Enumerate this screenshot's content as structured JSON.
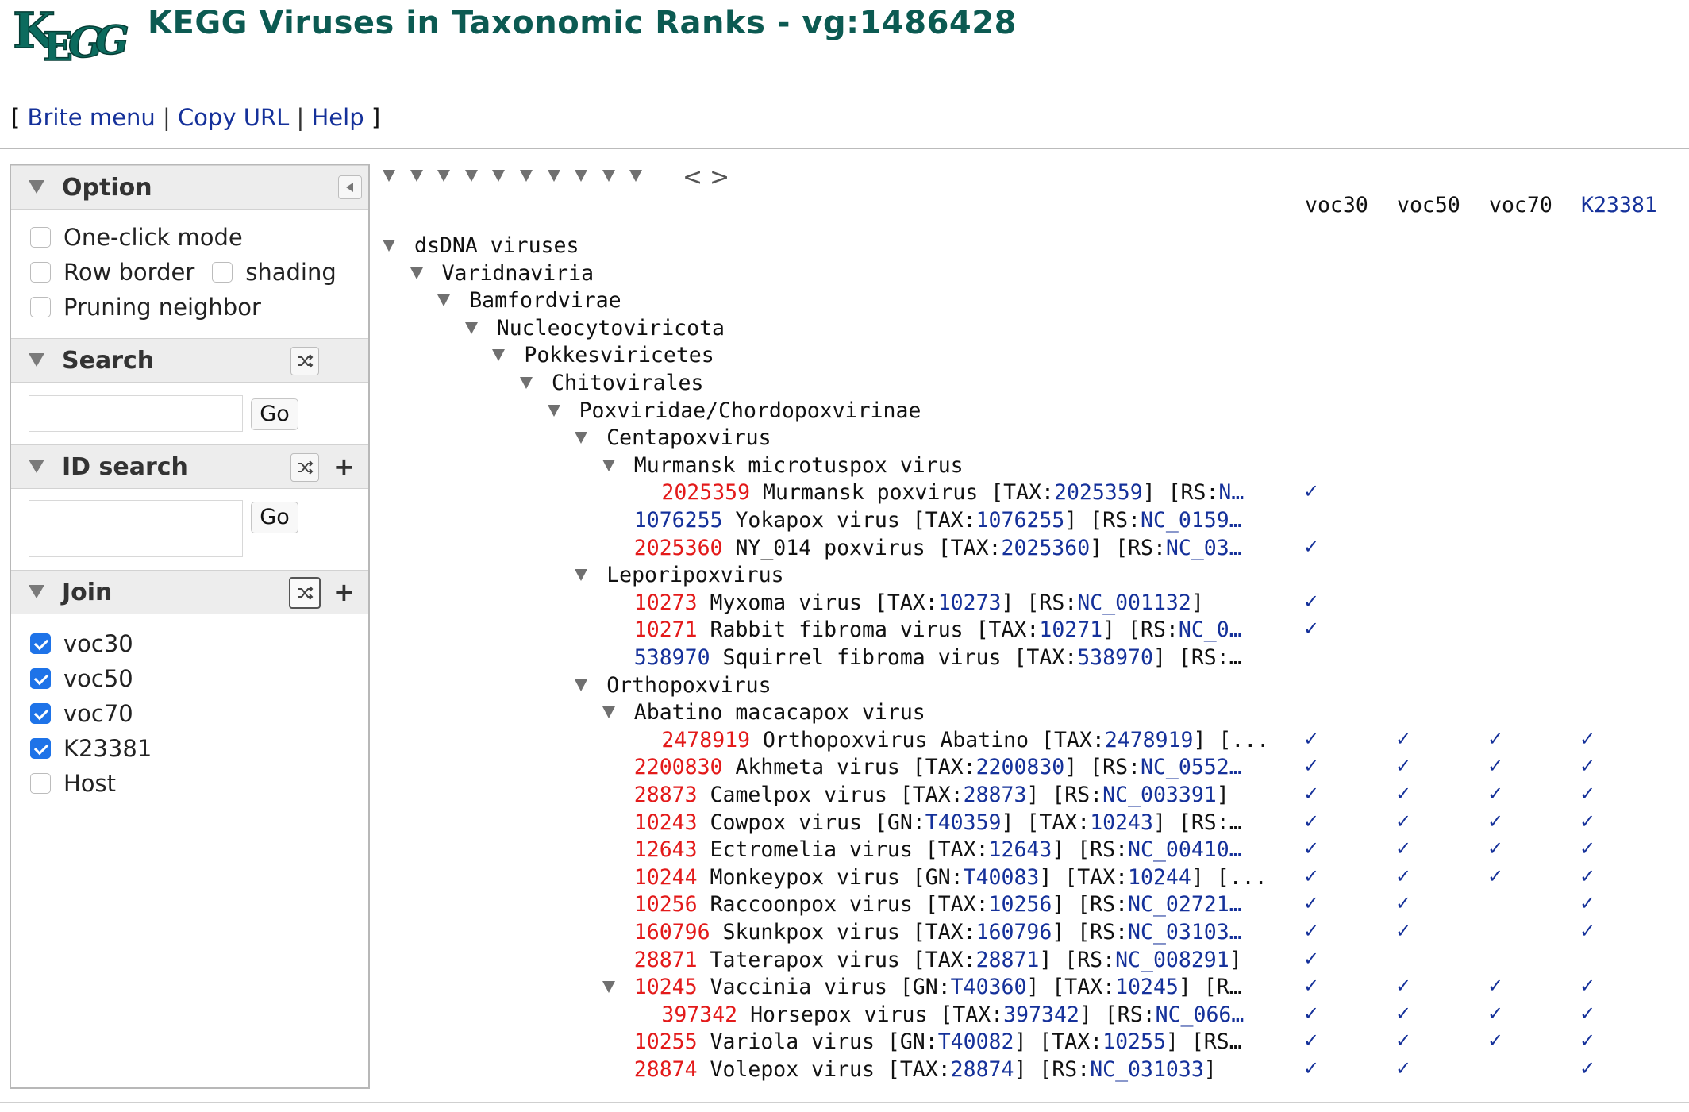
{
  "header": {
    "logo_text": "KEGG",
    "title": "KEGG Viruses in Taxonomic Ranks - vg:1486428",
    "menu": {
      "open": "[",
      "close": "]",
      "sep": "|",
      "brite": "Brite menu",
      "copy": "Copy URL",
      "help": "Help"
    }
  },
  "colors": {
    "title": "#0c5a52",
    "link": "#15319a",
    "id_red": "#e31a1a",
    "checkbox": "#1e73e8"
  },
  "left_panel": {
    "option": {
      "title": "Option",
      "items": [
        {
          "label": "One-click mode",
          "checked": false
        },
        {
          "label": "Row border",
          "checked": false
        },
        {
          "label": "shading",
          "checked": false
        },
        {
          "label": "Pruning neighbor",
          "checked": false
        }
      ]
    },
    "search": {
      "title": "Search",
      "value": "",
      "go": "Go",
      "icon": "shuffle-icon"
    },
    "id_search": {
      "title": "ID search",
      "value": "",
      "go": "Go",
      "icon": "shuffle-icon",
      "plus": "+"
    },
    "join": {
      "title": "Join",
      "plus": "+",
      "icon": "shuffle-icon",
      "items": [
        {
          "label": "voc30",
          "checked": true
        },
        {
          "label": "voc50",
          "checked": true
        },
        {
          "label": "voc70",
          "checked": true
        },
        {
          "label": "K23381",
          "checked": true
        },
        {
          "label": "Host",
          "checked": false
        }
      ]
    }
  },
  "tree": {
    "nav_prev": "<",
    "nav_next": ">",
    "columns": [
      "voc30",
      "voc50",
      "voc70",
      "K23381"
    ],
    "check_symbol": "✓",
    "rows": [
      {
        "indent": 0,
        "tri": true,
        "parts": [
          [
            "n",
            "dsDNA viruses"
          ]
        ],
        "checks": [
          0,
          0,
          0,
          0
        ]
      },
      {
        "indent": 1,
        "tri": true,
        "parts": [
          [
            "n",
            "Varidnaviria"
          ]
        ],
        "checks": [
          0,
          0,
          0,
          0
        ]
      },
      {
        "indent": 2,
        "tri": true,
        "parts": [
          [
            "n",
            "Bamfordvirae"
          ]
        ],
        "checks": [
          0,
          0,
          0,
          0
        ]
      },
      {
        "indent": 3,
        "tri": true,
        "parts": [
          [
            "n",
            "Nucleocytoviricota"
          ]
        ],
        "checks": [
          0,
          0,
          0,
          0
        ]
      },
      {
        "indent": 4,
        "tri": true,
        "parts": [
          [
            "n",
            "Pokkesviricetes"
          ]
        ],
        "checks": [
          0,
          0,
          0,
          0
        ]
      },
      {
        "indent": 5,
        "tri": true,
        "parts": [
          [
            "n",
            "Chitovirales"
          ]
        ],
        "checks": [
          0,
          0,
          0,
          0
        ]
      },
      {
        "indent": 6,
        "tri": true,
        "parts": [
          [
            "n",
            "Poxviridae/Chordopoxvirinae"
          ]
        ],
        "checks": [
          0,
          0,
          0,
          0
        ]
      },
      {
        "indent": 7,
        "tri": true,
        "parts": [
          [
            "n",
            "Centapoxvirus"
          ]
        ],
        "checks": [
          0,
          0,
          0,
          0
        ]
      },
      {
        "indent": 8,
        "tri": true,
        "parts": [
          [
            "n",
            "Murmansk microtuspox virus"
          ]
        ],
        "checks": [
          0,
          0,
          0,
          0
        ]
      },
      {
        "indent": 9,
        "tri": false,
        "parts": [
          [
            "r",
            "2025359"
          ],
          [
            "n",
            " Murmansk poxvirus [TAX:"
          ],
          [
            "b",
            "2025359"
          ],
          [
            "n",
            "] [RS:"
          ],
          [
            "b",
            "N…"
          ]
        ],
        "checks": [
          1,
          0,
          0,
          0
        ]
      },
      {
        "indent": 8,
        "tri": false,
        "parts": [
          [
            "b",
            "1076255"
          ],
          [
            "n",
            " Yokapox virus [TAX:"
          ],
          [
            "b",
            "1076255"
          ],
          [
            "n",
            "] [RS:"
          ],
          [
            "b",
            "NC_0159…"
          ]
        ],
        "checks": [
          0,
          0,
          0,
          0
        ]
      },
      {
        "indent": 8,
        "tri": false,
        "parts": [
          [
            "r",
            "2025360"
          ],
          [
            "n",
            " NY_014 poxvirus [TAX:"
          ],
          [
            "b",
            "2025360"
          ],
          [
            "n",
            "] [RS:"
          ],
          [
            "b",
            "NC_03…"
          ]
        ],
        "checks": [
          1,
          0,
          0,
          0
        ]
      },
      {
        "indent": 7,
        "tri": true,
        "parts": [
          [
            "n",
            "Leporipoxvirus"
          ]
        ],
        "checks": [
          0,
          0,
          0,
          0
        ]
      },
      {
        "indent": 8,
        "tri": false,
        "parts": [
          [
            "r",
            "10273"
          ],
          [
            "n",
            " Myxoma virus [TAX:"
          ],
          [
            "b",
            "10273"
          ],
          [
            "n",
            "] [RS:"
          ],
          [
            "b",
            "NC_001132"
          ],
          [
            "n",
            "]"
          ]
        ],
        "checks": [
          1,
          0,
          0,
          0
        ]
      },
      {
        "indent": 8,
        "tri": false,
        "parts": [
          [
            "r",
            "10271"
          ],
          [
            "n",
            " Rabbit fibroma virus [TAX:"
          ],
          [
            "b",
            "10271"
          ],
          [
            "n",
            "] [RS:"
          ],
          [
            "b",
            "NC_0…"
          ]
        ],
        "checks": [
          1,
          0,
          0,
          0
        ]
      },
      {
        "indent": 8,
        "tri": false,
        "parts": [
          [
            "b",
            "538970"
          ],
          [
            "n",
            " Squirrel fibroma virus [TAX:"
          ],
          [
            "b",
            "538970"
          ],
          [
            "n",
            "] [RS:…"
          ]
        ],
        "checks": [
          0,
          0,
          0,
          0
        ]
      },
      {
        "indent": 7,
        "tri": true,
        "parts": [
          [
            "n",
            "Orthopoxvirus"
          ]
        ],
        "checks": [
          0,
          0,
          0,
          0
        ]
      },
      {
        "indent": 8,
        "tri": true,
        "parts": [
          [
            "n",
            "Abatino macacapox virus"
          ]
        ],
        "checks": [
          0,
          0,
          0,
          0
        ]
      },
      {
        "indent": 9,
        "tri": false,
        "parts": [
          [
            "r",
            "2478919"
          ],
          [
            "n",
            " Orthopoxvirus Abatino [TAX:"
          ],
          [
            "b",
            "2478919"
          ],
          [
            "n",
            "] [..."
          ]
        ],
        "checks": [
          1,
          1,
          1,
          1
        ]
      },
      {
        "indent": 8,
        "tri": false,
        "parts": [
          [
            "r",
            "2200830"
          ],
          [
            "n",
            " Akhmeta virus [TAX:"
          ],
          [
            "b",
            "2200830"
          ],
          [
            "n",
            "] [RS:"
          ],
          [
            "b",
            "NC_0552…"
          ]
        ],
        "checks": [
          1,
          1,
          1,
          1
        ]
      },
      {
        "indent": 8,
        "tri": false,
        "parts": [
          [
            "r",
            "28873"
          ],
          [
            "n",
            " Camelpox virus [TAX:"
          ],
          [
            "b",
            "28873"
          ],
          [
            "n",
            "] [RS:"
          ],
          [
            "b",
            "NC_003391"
          ],
          [
            "n",
            "]"
          ]
        ],
        "checks": [
          1,
          1,
          1,
          1
        ]
      },
      {
        "indent": 8,
        "tri": false,
        "parts": [
          [
            "r",
            "10243"
          ],
          [
            "n",
            " Cowpox virus [GN:"
          ],
          [
            "b",
            "T40359"
          ],
          [
            "n",
            "] [TAX:"
          ],
          [
            "b",
            "10243"
          ],
          [
            "n",
            "] [RS:…"
          ]
        ],
        "checks": [
          1,
          1,
          1,
          1
        ]
      },
      {
        "indent": 8,
        "tri": false,
        "parts": [
          [
            "r",
            "12643"
          ],
          [
            "n",
            " Ectromelia virus [TAX:"
          ],
          [
            "b",
            "12643"
          ],
          [
            "n",
            "] [RS:"
          ],
          [
            "b",
            "NC_00410…"
          ]
        ],
        "checks": [
          1,
          1,
          1,
          1
        ]
      },
      {
        "indent": 8,
        "tri": false,
        "parts": [
          [
            "r",
            "10244"
          ],
          [
            "n",
            " Monkeypox virus [GN:"
          ],
          [
            "b",
            "T40083"
          ],
          [
            "n",
            "] [TAX:"
          ],
          [
            "b",
            "10244"
          ],
          [
            "n",
            "] [..."
          ]
        ],
        "checks": [
          1,
          1,
          1,
          1
        ]
      },
      {
        "indent": 8,
        "tri": false,
        "parts": [
          [
            "r",
            "10256"
          ],
          [
            "n",
            " Raccoonpox virus [TAX:"
          ],
          [
            "b",
            "10256"
          ],
          [
            "n",
            "] [RS:"
          ],
          [
            "b",
            "NC_02721…"
          ]
        ],
        "checks": [
          1,
          1,
          0,
          1
        ]
      },
      {
        "indent": 8,
        "tri": false,
        "parts": [
          [
            "r",
            "160796"
          ],
          [
            "n",
            " Skunkpox virus [TAX:"
          ],
          [
            "b",
            "160796"
          ],
          [
            "n",
            "] [RS:"
          ],
          [
            "b",
            "NC_03103…"
          ]
        ],
        "checks": [
          1,
          1,
          0,
          1
        ]
      },
      {
        "indent": 8,
        "tri": false,
        "parts": [
          [
            "r",
            "28871"
          ],
          [
            "n",
            " Taterapox virus [TAX:"
          ],
          [
            "b",
            "28871"
          ],
          [
            "n",
            "] [RS:"
          ],
          [
            "b",
            "NC_008291"
          ],
          [
            "n",
            "]"
          ]
        ],
        "checks": [
          1,
          0,
          0,
          0
        ]
      },
      {
        "indent": 8,
        "tri": true,
        "parts": [
          [
            "r",
            "10245"
          ],
          [
            "n",
            " Vaccinia virus [GN:"
          ],
          [
            "b",
            "T40360"
          ],
          [
            "n",
            "] [TAX:"
          ],
          [
            "b",
            "10245"
          ],
          [
            "n",
            "] [R…"
          ]
        ],
        "checks": [
          1,
          1,
          1,
          1
        ]
      },
      {
        "indent": 9,
        "tri": false,
        "parts": [
          [
            "r",
            "397342"
          ],
          [
            "n",
            " Horsepox virus [TAX:"
          ],
          [
            "b",
            "397342"
          ],
          [
            "n",
            "] [RS:"
          ],
          [
            "b",
            "NC_066…"
          ]
        ],
        "checks": [
          1,
          1,
          1,
          1
        ]
      },
      {
        "indent": 8,
        "tri": false,
        "parts": [
          [
            "r",
            "10255"
          ],
          [
            "n",
            " Variola virus [GN:"
          ],
          [
            "b",
            "T40082"
          ],
          [
            "n",
            "] [TAX:"
          ],
          [
            "b",
            "10255"
          ],
          [
            "n",
            "] [RS…"
          ]
        ],
        "checks": [
          1,
          1,
          1,
          1
        ]
      },
      {
        "indent": 8,
        "tri": false,
        "parts": [
          [
            "r",
            "28874"
          ],
          [
            "n",
            " Volepox virus [TAX:"
          ],
          [
            "b",
            "28874"
          ],
          [
            "n",
            "] [RS:"
          ],
          [
            "b",
            "NC_031033"
          ],
          [
            "n",
            "]"
          ]
        ],
        "checks": [
          1,
          1,
          0,
          1
        ]
      }
    ]
  }
}
